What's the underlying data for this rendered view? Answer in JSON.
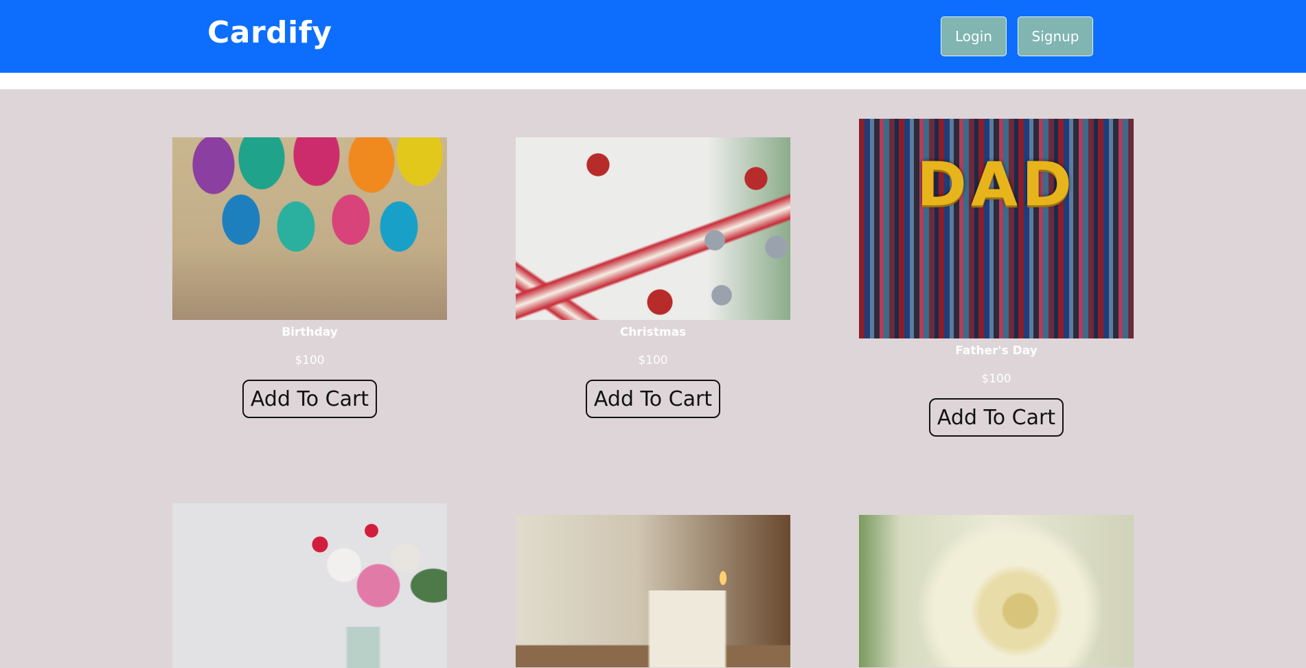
{
  "navbar": {
    "brand": "Cardify",
    "login_label": "Login",
    "signup_label": "Signup"
  },
  "cards": [
    {
      "title": "Birthday",
      "price": "$100",
      "button": "Add To Cart",
      "image": "birthday-balloons-image"
    },
    {
      "title": "Christmas",
      "price": "$100",
      "button": "Add To Cart",
      "image": "christmas-ribbons-bells-image"
    },
    {
      "title": "Father's Day",
      "price": "$100",
      "button": "Add To Cart",
      "image": "dad-ties-image"
    },
    {
      "title": "",
      "price": "",
      "button": "",
      "image": "flower-bouquet-image"
    },
    {
      "title": "",
      "price": "",
      "button": "",
      "image": "thank-you-candle-image"
    },
    {
      "title": "",
      "price": "",
      "button": "",
      "image": "white-rose-image"
    }
  ],
  "dad_letters": "DAD",
  "colors": {
    "navbar": "#0d6efd",
    "nav_button": "#80b5b2",
    "page_background": "#ddd5d7",
    "card_text": "#ffffff"
  }
}
